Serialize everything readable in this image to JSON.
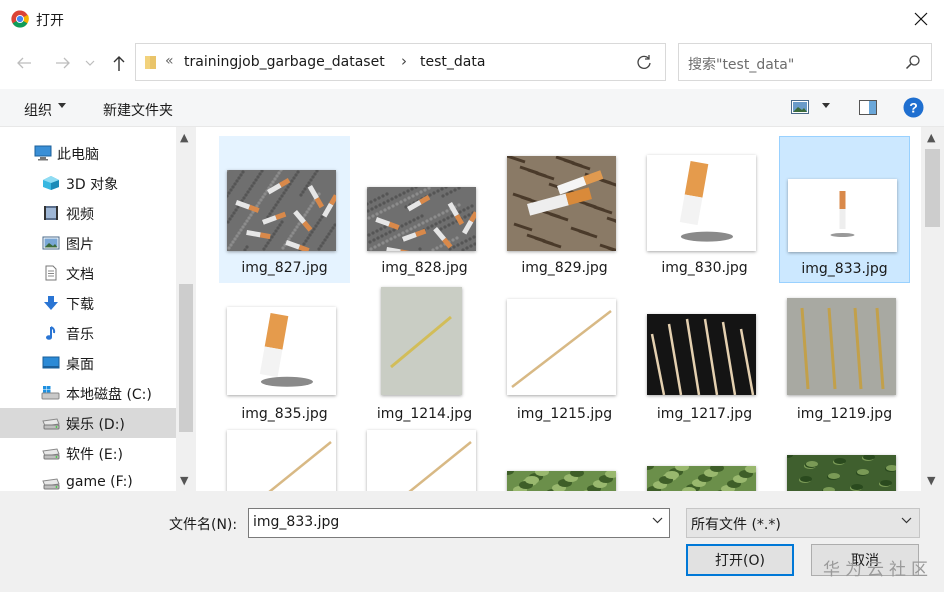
{
  "window": {
    "title": "打开",
    "close_icon": "close-icon"
  },
  "address": {
    "parts": [
      "trainingjob_garbage_dataset",
      "test_data"
    ],
    "overflow_marker": "«",
    "separator": "›"
  },
  "search": {
    "placeholder": "搜索\"test_data\""
  },
  "toolbar": {
    "organize_label": "组织",
    "new_folder_label": "新建文件夹"
  },
  "sidebar": {
    "items": [
      {
        "label": "此电脑",
        "icon": "computer-icon"
      },
      {
        "label": "3D 对象",
        "icon": "3d-objects-icon"
      },
      {
        "label": "视频",
        "icon": "videos-icon"
      },
      {
        "label": "图片",
        "icon": "pictures-icon"
      },
      {
        "label": "文档",
        "icon": "documents-icon"
      },
      {
        "label": "下载",
        "icon": "downloads-icon"
      },
      {
        "label": "音乐",
        "icon": "music-icon"
      },
      {
        "label": "桌面",
        "icon": "desktop-icon"
      },
      {
        "label": "本地磁盘 (C:)",
        "icon": "windows-drive-icon"
      },
      {
        "label": "娱乐 (D:)",
        "icon": "drive-icon",
        "selected": true
      },
      {
        "label": "软件 (E:)",
        "icon": "drive-icon"
      },
      {
        "label": "game (F:)",
        "icon": "drive-icon"
      }
    ]
  },
  "files": [
    {
      "name": "img_827.jpg",
      "thumb": "cigarettes-gravel"
    },
    {
      "name": "img_828.jpg",
      "thumb": "cigarettes-gravel"
    },
    {
      "name": "img_829.jpg",
      "thumb": "cigarettes-leaves"
    },
    {
      "name": "img_830.jpg",
      "thumb": "cigarette-ash"
    },
    {
      "name": "img_833.jpg",
      "thumb": "cigarette-small",
      "selected": true
    },
    {
      "name": "img_835.jpg",
      "thumb": "cigarette-ash"
    },
    {
      "name": "img_1214.jpg",
      "thumb": "toothpick-cloth"
    },
    {
      "name": "img_1215.jpg",
      "thumb": "toothpick-white"
    },
    {
      "name": "img_1217.jpg",
      "thumb": "toothpicks-black"
    },
    {
      "name": "img_1219.jpg",
      "thumb": "toothpicks-grey"
    },
    {
      "name": "",
      "thumb": "toothpick-white"
    },
    {
      "name": "",
      "thumb": "toothpick-white"
    },
    {
      "name": "",
      "thumb": "greens"
    },
    {
      "name": "",
      "thumb": "greens"
    },
    {
      "name": "",
      "thumb": "greens-dark"
    }
  ],
  "footer": {
    "filename_label": "文件名(N):",
    "filename_value": "img_833.jpg",
    "filetype_value": "所有文件 (*.*)",
    "open_label": "打开(O)",
    "cancel_label": "取消",
    "watermark": "华为云社区"
  },
  "colors": {
    "selection_bg": "#cce8ff",
    "selection_border": "#99d1ff",
    "accent": "#0078d7"
  }
}
